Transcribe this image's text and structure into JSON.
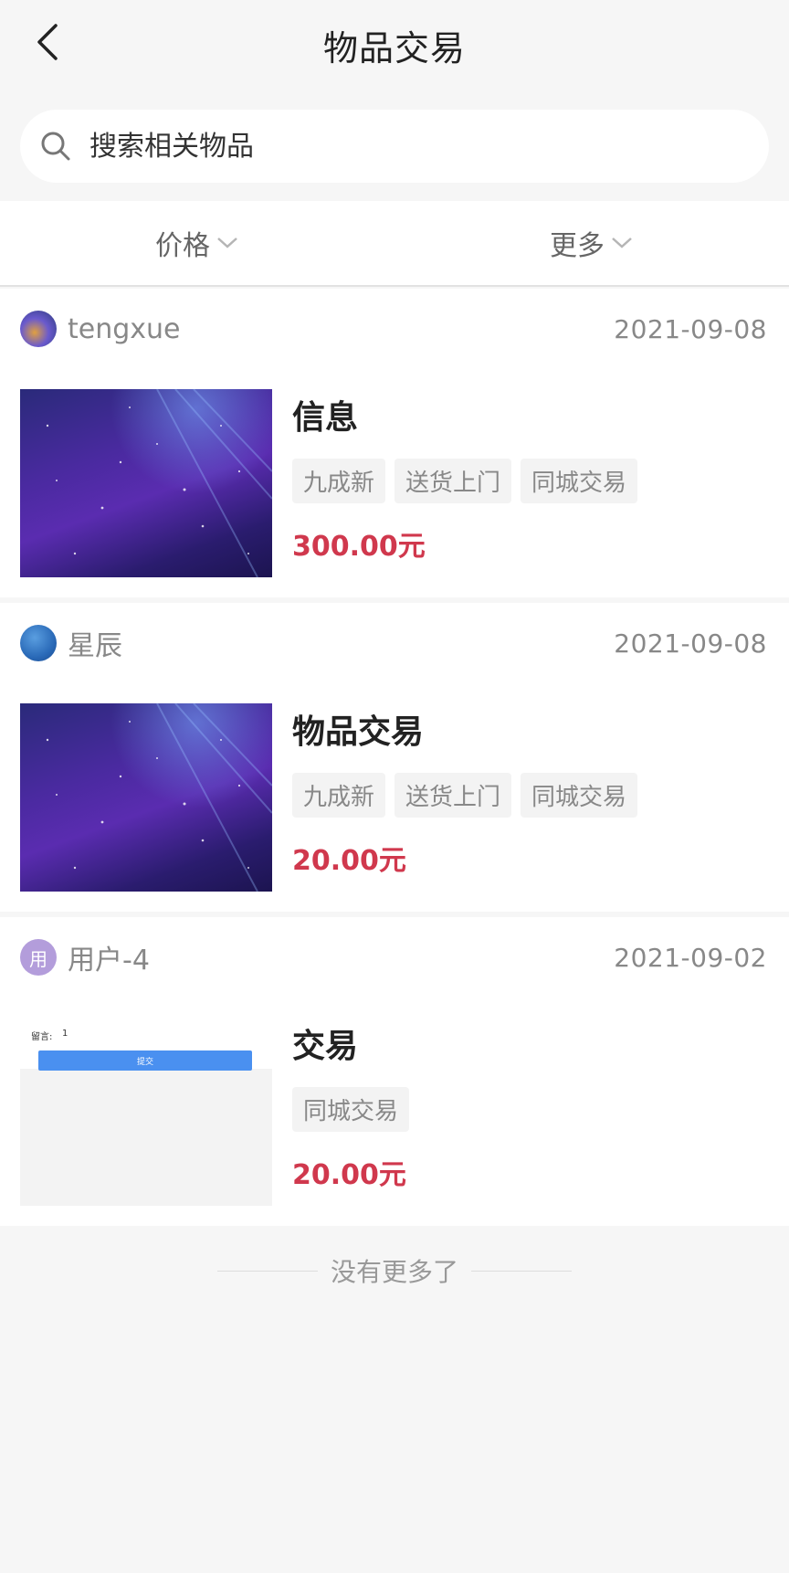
{
  "header": {
    "title": "物品交易",
    "back_icon": "chevron-left-icon"
  },
  "search": {
    "placeholder": "搜索相关物品",
    "icon": "search-icon"
  },
  "filters": [
    {
      "label": "价格",
      "icon": "chevron-down-icon"
    },
    {
      "label": "更多",
      "icon": "chevron-down-icon"
    }
  ],
  "items": [
    {
      "username": "tengxue",
      "date": "2021-09-08",
      "title": "信息",
      "tags": [
        "九成新",
        "送货上门",
        "同城交易"
      ],
      "price": "300.00元"
    },
    {
      "username": "星辰",
      "date": "2021-09-08",
      "title": "物品交易",
      "tags": [
        "九成新",
        "送货上门",
        "同城交易"
      ],
      "price": "20.00元"
    },
    {
      "username": "用户-4",
      "avatar_text": "用",
      "date": "2021-09-02",
      "title": "交易",
      "tags": [
        "同城交易"
      ],
      "price": "20.00元",
      "thumb": {
        "label": "留言:",
        "value": "1",
        "button": "提交"
      }
    }
  ],
  "footer": {
    "end_text": "没有更多了"
  },
  "colors": {
    "price": "#d0384d",
    "background": "#f6f6f6",
    "thumb_button": "#4a90f0"
  }
}
